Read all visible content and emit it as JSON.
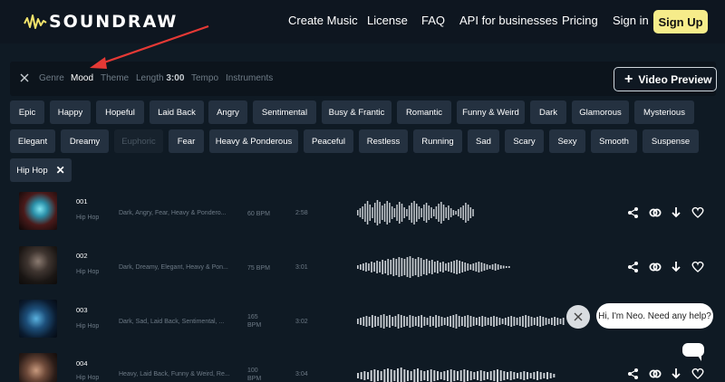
{
  "brand": {
    "name": "SOUNDRAW"
  },
  "nav": {
    "links": [
      "Create Music",
      "License",
      "FAQ",
      "API for businesses",
      "Pricing",
      "Sign in"
    ],
    "signup_label": "Sign Up"
  },
  "filters": {
    "tabs": [
      {
        "label": "Genre",
        "active": false
      },
      {
        "label": "Mood",
        "active": true
      },
      {
        "label": "Theme",
        "active": false
      },
      {
        "label": "Length",
        "value": "3:00",
        "active": false
      },
      {
        "label": "Tempo",
        "active": false
      },
      {
        "label": "Instruments",
        "active": false
      }
    ],
    "video_preview_label": "Video Preview"
  },
  "moods": [
    {
      "label": "Epic",
      "state": "normal"
    },
    {
      "label": "Happy",
      "state": "normal"
    },
    {
      "label": "Hopeful",
      "state": "normal"
    },
    {
      "label": "Laid Back",
      "state": "normal"
    },
    {
      "label": "Angry",
      "state": "normal"
    },
    {
      "label": "Sentimental",
      "state": "normal"
    },
    {
      "label": "Busy & Frantic",
      "state": "normal"
    },
    {
      "label": "Romantic",
      "state": "normal"
    },
    {
      "label": "Funny & Weird",
      "state": "normal"
    },
    {
      "label": "Dark",
      "state": "normal"
    },
    {
      "label": "Glamorous",
      "state": "normal"
    },
    {
      "label": "Mysterious",
      "state": "normal"
    },
    {
      "label": "Elegant",
      "state": "normal"
    },
    {
      "label": "Dreamy",
      "state": "normal"
    },
    {
      "label": "Euphoric",
      "state": "dim"
    },
    {
      "label": "Fear",
      "state": "normal"
    },
    {
      "label": "Heavy & Ponderous",
      "state": "normal"
    },
    {
      "label": "Peaceful",
      "state": "normal"
    },
    {
      "label": "Restless",
      "state": "normal"
    },
    {
      "label": "Running",
      "state": "normal"
    },
    {
      "label": "Sad",
      "state": "normal"
    },
    {
      "label": "Scary",
      "state": "normal"
    },
    {
      "label": "Sexy",
      "state": "normal"
    },
    {
      "label": "Smooth",
      "state": "normal"
    },
    {
      "label": "Suspense",
      "state": "normal"
    },
    {
      "label": "Hip Hop",
      "state": "selected"
    }
  ],
  "tracks": [
    {
      "number": "001",
      "genre": "Hip Hop",
      "moods": "Dark, Angry, Fear, Heavy & Pondero...",
      "bpm": "60 BPM",
      "length": "2:58"
    },
    {
      "number": "002",
      "genre": "Hip Hop",
      "moods": "Dark, Dreamy, Elegant, Heavy & Pon...",
      "bpm": "75 BPM",
      "length": "3:01"
    },
    {
      "number": "003",
      "genre": "Hip Hop",
      "moods": "Dark, Sad, Laid Back, Sentimental, ...",
      "bpm": "165 BPM",
      "length": "3:02"
    },
    {
      "number": "004",
      "genre": "Hip Hop",
      "moods": "Heavy, Laid Back, Funny & Weird, Re...",
      "bpm": "100 BPM",
      "length": "3:04"
    }
  ],
  "chat": {
    "message": "Hi, I'm Neo. Need any help?"
  },
  "colors": {
    "accent": "#f6ec8a",
    "background": "#0f1a24",
    "chip": "#243140",
    "annotation_arrow": "#e53935"
  },
  "icons": [
    "close-icon",
    "plus-icon",
    "share-icon",
    "link-icon",
    "download-icon",
    "heart-icon",
    "chat-icon"
  ]
}
